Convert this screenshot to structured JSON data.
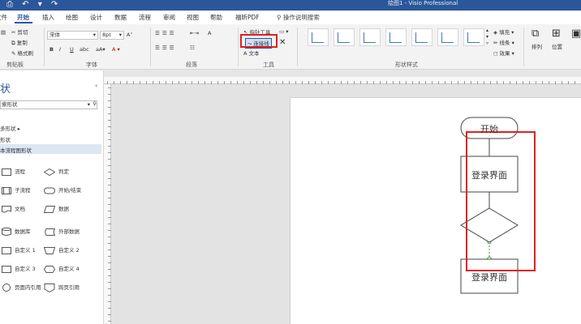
{
  "window": {
    "title": "绘图1 - Visio Professional"
  },
  "tabs": [
    {
      "label": "文件"
    },
    {
      "label": "开始"
    },
    {
      "label": "插入"
    },
    {
      "label": "绘图"
    },
    {
      "label": "设计"
    },
    {
      "label": "数据"
    },
    {
      "label": "流程"
    },
    {
      "label": "审阅"
    },
    {
      "label": "视图"
    },
    {
      "label": "帮助"
    },
    {
      "label": "福昕PDF"
    }
  ],
  "tell_me": "操作说明搜索",
  "ribbon": {
    "clipboard": {
      "cut": "剪切",
      "copy": "复制",
      "format_painter": "格式刷",
      "label": "剪贴板"
    },
    "font": {
      "font_name": "宋体",
      "font_size": "8pt",
      "bold": "B",
      "italic": "I",
      "underline": "U",
      "label": "字体"
    },
    "paragraph": {
      "label": "段落"
    },
    "tools": {
      "pointer": "指针工具",
      "connector": "连接线",
      "text": "文本",
      "label": "工具"
    },
    "shape_styles": {
      "label": "形状样式",
      "fill": "填充",
      "line": "线条",
      "effects": "效果"
    },
    "arrange": {
      "arrange": "排列",
      "position": "位置"
    }
  },
  "shapes_pane": {
    "title": "状",
    "search_value": "索形状",
    "links": [
      "多形状",
      "形状",
      "本流程图形状"
    ],
    "stencils": [
      {
        "label": "流程",
        "icon": "process-shape"
      },
      {
        "label": "判定",
        "icon": "decision-shape"
      },
      {
        "label": "子流程",
        "icon": "subprocess-shape"
      },
      {
        "label": "开始/结束",
        "icon": "terminator-shape"
      },
      {
        "label": "文档",
        "icon": "document-shape"
      },
      {
        "label": "数据",
        "icon": "data-shape"
      },
      {
        "label": "数据库",
        "icon": "database-shape"
      },
      {
        "label": "外部数据",
        "icon": "external-data-shape"
      },
      {
        "label": "自定义 1",
        "icon": "custom1-shape"
      },
      {
        "label": "自定义 2",
        "icon": "custom2-shape"
      },
      {
        "label": "自定义 3",
        "icon": "custom3-shape"
      },
      {
        "label": "自定义 4",
        "icon": "custom4-shape"
      },
      {
        "label": "页面内引用",
        "icon": "on-page-reference-shape"
      },
      {
        "label": "跨页引用",
        "icon": "off-page-reference-shape"
      }
    ]
  },
  "diagram": {
    "start": "开始",
    "login1": "登录界面",
    "login2": "登录界面"
  },
  "colors": {
    "accent": "#2b579a",
    "highlight": "#e02020"
  }
}
